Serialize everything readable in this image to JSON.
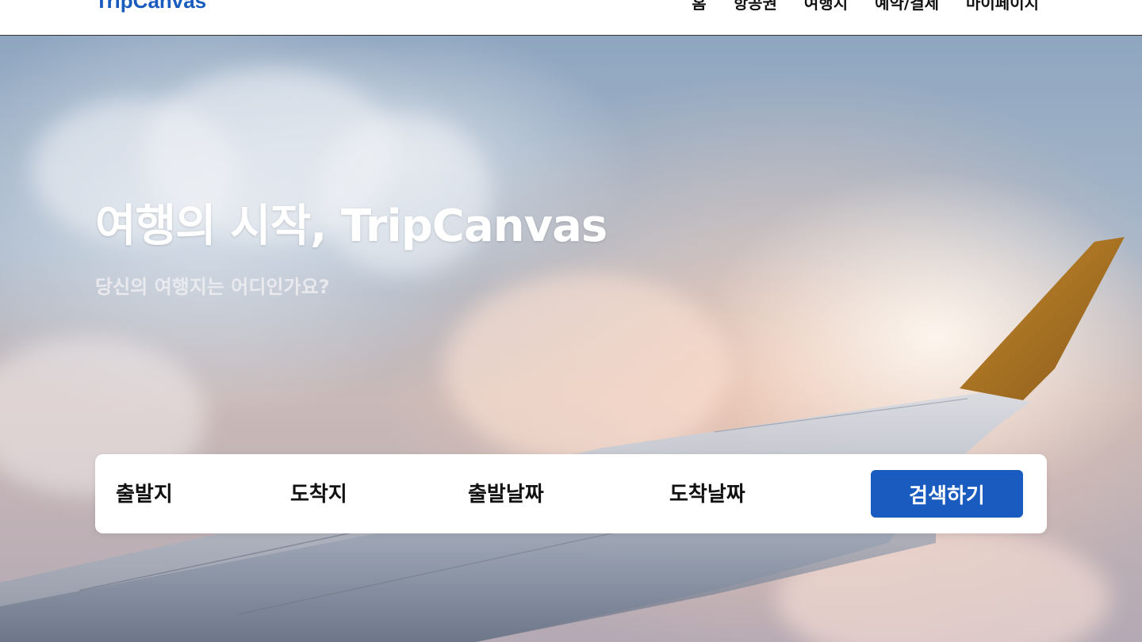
{
  "header": {
    "logo": "TripCanvas",
    "nav": [
      "홈",
      "항공권",
      "여행지",
      "예약/결제",
      "마이페이지"
    ]
  },
  "hero": {
    "title": "여행의 시작, TripCanvas",
    "subtitle": "당신의 여행지는 어디인가요?"
  },
  "search": {
    "origin": "출발지",
    "destination": "도착지",
    "depart_date": "출발날짜",
    "arrive_date": "도착날짜",
    "button": "검색하기"
  },
  "colors": {
    "brand": "#1a5bbf",
    "header_bg": "#ffffff",
    "search_bg": "#ffffff"
  },
  "background_image": "airplane-wing-above-clouds"
}
